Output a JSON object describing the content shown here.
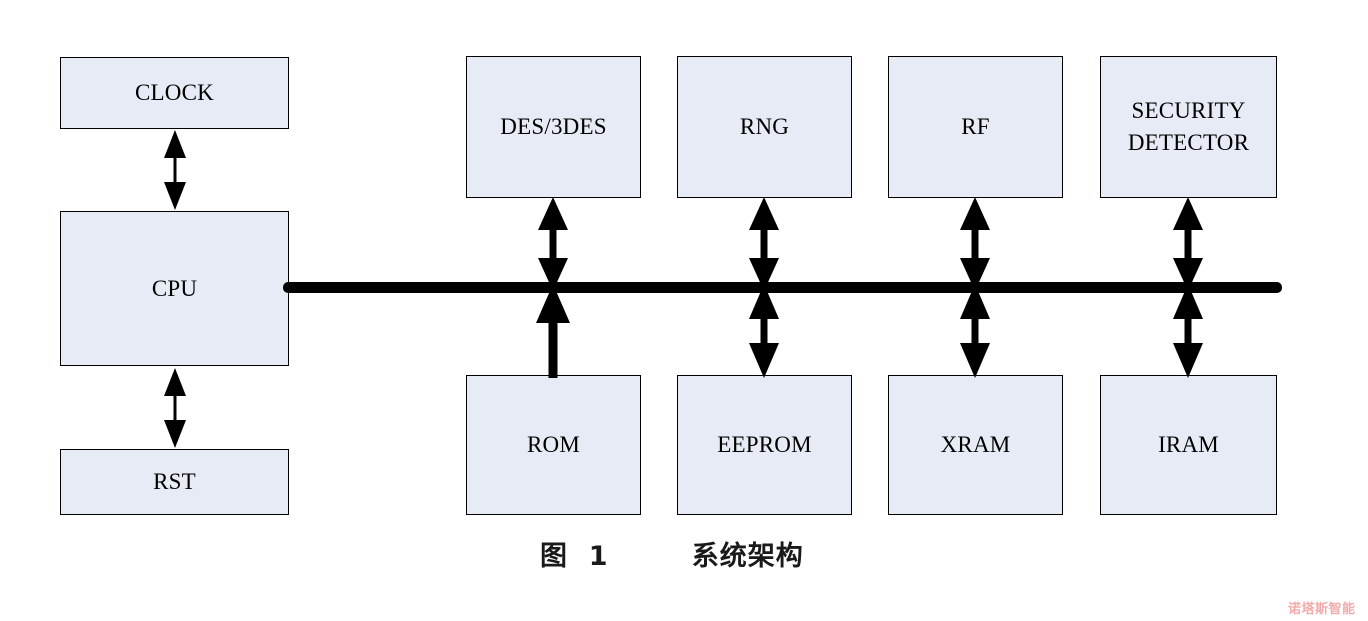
{
  "figure": {
    "caption": "图  1        系统架构",
    "watermark": "诺塔斯智能",
    "background_color": "#ffffff",
    "block_fill_color": "#e6ebf5",
    "block_border_color": "#000000",
    "bus_color": "#000000",
    "watermark_color": "#f0a0a0"
  },
  "blocks": {
    "clock": {
      "label": "CLOCK"
    },
    "cpu": {
      "label": "CPU"
    },
    "rst": {
      "label": "RST"
    },
    "des": {
      "label": "DES/3DES"
    },
    "rng": {
      "label": "RNG"
    },
    "rf": {
      "label": "RF"
    },
    "security_detector": {
      "label": "SECURITY\nDETECTOR"
    },
    "rom": {
      "label": "ROM"
    },
    "eeprom": {
      "label": "EEPROM"
    },
    "xram": {
      "label": "XRAM"
    },
    "iram": {
      "label": "IRAM"
    }
  },
  "connections": [
    {
      "name": "clock-cpu",
      "type": "double-arrow",
      "orientation": "vertical"
    },
    {
      "name": "cpu-rst",
      "type": "double-arrow",
      "orientation": "vertical"
    },
    {
      "name": "cpu-bus",
      "type": "line",
      "orientation": "horizontal"
    },
    {
      "name": "des-bus",
      "type": "double-arrow",
      "orientation": "vertical"
    },
    {
      "name": "rng-bus",
      "type": "double-arrow",
      "orientation": "vertical"
    },
    {
      "name": "rf-bus",
      "type": "double-arrow",
      "orientation": "vertical"
    },
    {
      "name": "security-detector-bus",
      "type": "double-arrow",
      "orientation": "vertical"
    },
    {
      "name": "rom-bus",
      "type": "single-arrow",
      "orientation": "vertical"
    },
    {
      "name": "eeprom-bus",
      "type": "double-arrow",
      "orientation": "vertical"
    },
    {
      "name": "xram-bus",
      "type": "double-arrow",
      "orientation": "vertical"
    },
    {
      "name": "iram-bus",
      "type": "double-arrow",
      "orientation": "vertical"
    }
  ]
}
